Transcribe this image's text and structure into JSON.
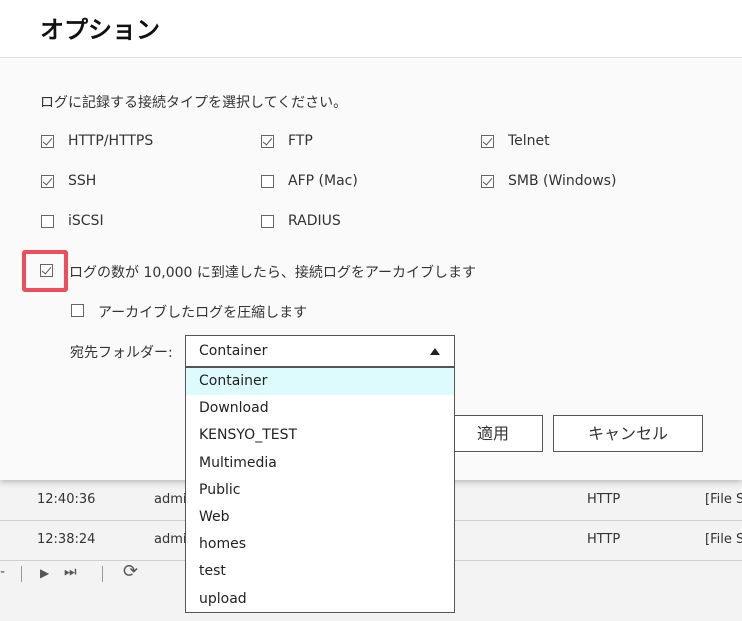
{
  "dialog": {
    "title": "オプション",
    "description": "ログに記録する接続タイプを選択してください。",
    "connection_types": [
      {
        "label": "HTTP/HTTPS",
        "checked": true
      },
      {
        "label": "FTP",
        "checked": true
      },
      {
        "label": "Telnet",
        "checked": true
      },
      {
        "label": "SSH",
        "checked": true
      },
      {
        "label": "AFP (Mac)",
        "checked": false
      },
      {
        "label": "SMB (Windows)",
        "checked": true
      },
      {
        "label": "iSCSI",
        "checked": false
      },
      {
        "label": "RADIUS",
        "checked": false
      }
    ],
    "archive": {
      "label": "ログの数が 10,000 に到達したら、接続ログをアーカイブします",
      "checked": true
    },
    "compress": {
      "label": "アーカイブしたログを圧縮します",
      "checked": false
    },
    "destination": {
      "label": "宛先フォルダー:",
      "selected": "Container",
      "options": [
        "Container",
        "Download",
        "KENSYO_TEST",
        "Multimedia",
        "Public",
        "Web",
        "homes",
        "test",
        "upload"
      ]
    },
    "buttons": {
      "apply": "適用",
      "cancel": "キャンセル"
    }
  },
  "background": {
    "rows": [
      {
        "time": "12:40:36",
        "user": "admi",
        "protocol": "HTTP",
        "result": "[File S"
      },
      {
        "time": "12:38:24",
        "user": "admi",
        "protocol": "HTTP",
        "result": "[File S"
      }
    ],
    "pager": {
      "prev_glyph": "-",
      "next_icon": "▶",
      "last_icon": "⏭",
      "refresh_icon": "⟳"
    }
  },
  "colors": {
    "highlight": "#ee4e5b",
    "dropdown_active": "#ddfbfc"
  }
}
